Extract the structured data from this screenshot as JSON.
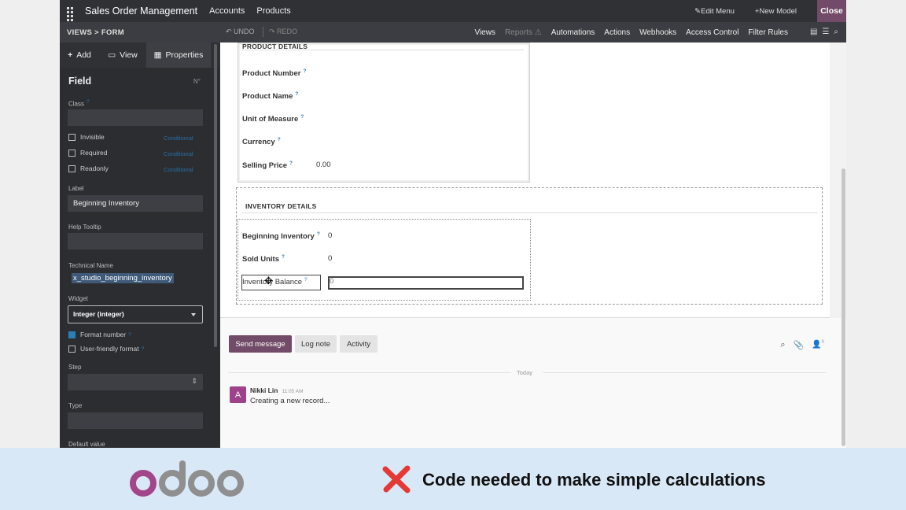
{
  "topbar": {
    "app": "Sales Order Management",
    "menu": [
      "Accounts",
      "Products"
    ],
    "edit_menu": "Edit Menu",
    "new_model": "New Model",
    "close": "Close"
  },
  "bar2": {
    "breadcrumb": "VIEWS > FORM",
    "undo": "UNDO",
    "redo": "REDO",
    "items": [
      "Views",
      "Reports",
      "Automations",
      "Actions",
      "Webhooks",
      "Access Control",
      "Filter Rules"
    ]
  },
  "sidebar": {
    "tabs": [
      "Add",
      "View",
      "Properties"
    ],
    "title": "Field",
    "class_label": "Class",
    "checkboxes": [
      {
        "label": "Invisible",
        "cond": "Conditional"
      },
      {
        "label": "Required",
        "cond": "Conditional"
      },
      {
        "label": "Readonly",
        "cond": "Conditional"
      }
    ],
    "label_label": "Label",
    "label_value": "Beginning Inventory",
    "help_label": "Help Tooltip",
    "tech_label": "Technical Name",
    "tech_value": "x_studio_beginning_inventory",
    "widget_label": "Widget",
    "widget_value": "Integer (integer)",
    "format_number": "Format number",
    "user_friendly": "User-friendly format",
    "step_label": "Step",
    "type_label": "Type",
    "default_label": "Default value"
  },
  "form": {
    "product_title": "PRODUCT DETAILS",
    "product_fields": [
      {
        "label": "Product Number",
        "value": ""
      },
      {
        "label": "Product Name",
        "value": ""
      },
      {
        "label": "Unit of Measure",
        "value": ""
      },
      {
        "label": "Currency",
        "value": ""
      },
      {
        "label": "Selling Price",
        "value": "0.00"
      }
    ],
    "inventory_title": "INVENTORY DETAILS",
    "inventory_fields": [
      {
        "label": "Beginning Inventory",
        "value": "0"
      },
      {
        "label": "Sold Units",
        "value": "0"
      },
      {
        "label": "Inventory Balance",
        "value": "0"
      }
    ]
  },
  "chatter": {
    "send": "Send message",
    "log": "Log note",
    "activity": "Activity",
    "today": "Today",
    "avatar": "A",
    "author": "Nikki Lin",
    "time": "11:05 AM",
    "message": "Creating a new record...",
    "followers": "0"
  },
  "banner": {
    "tagline": "Code needed to make simple calculations",
    "logo": "odoo"
  }
}
